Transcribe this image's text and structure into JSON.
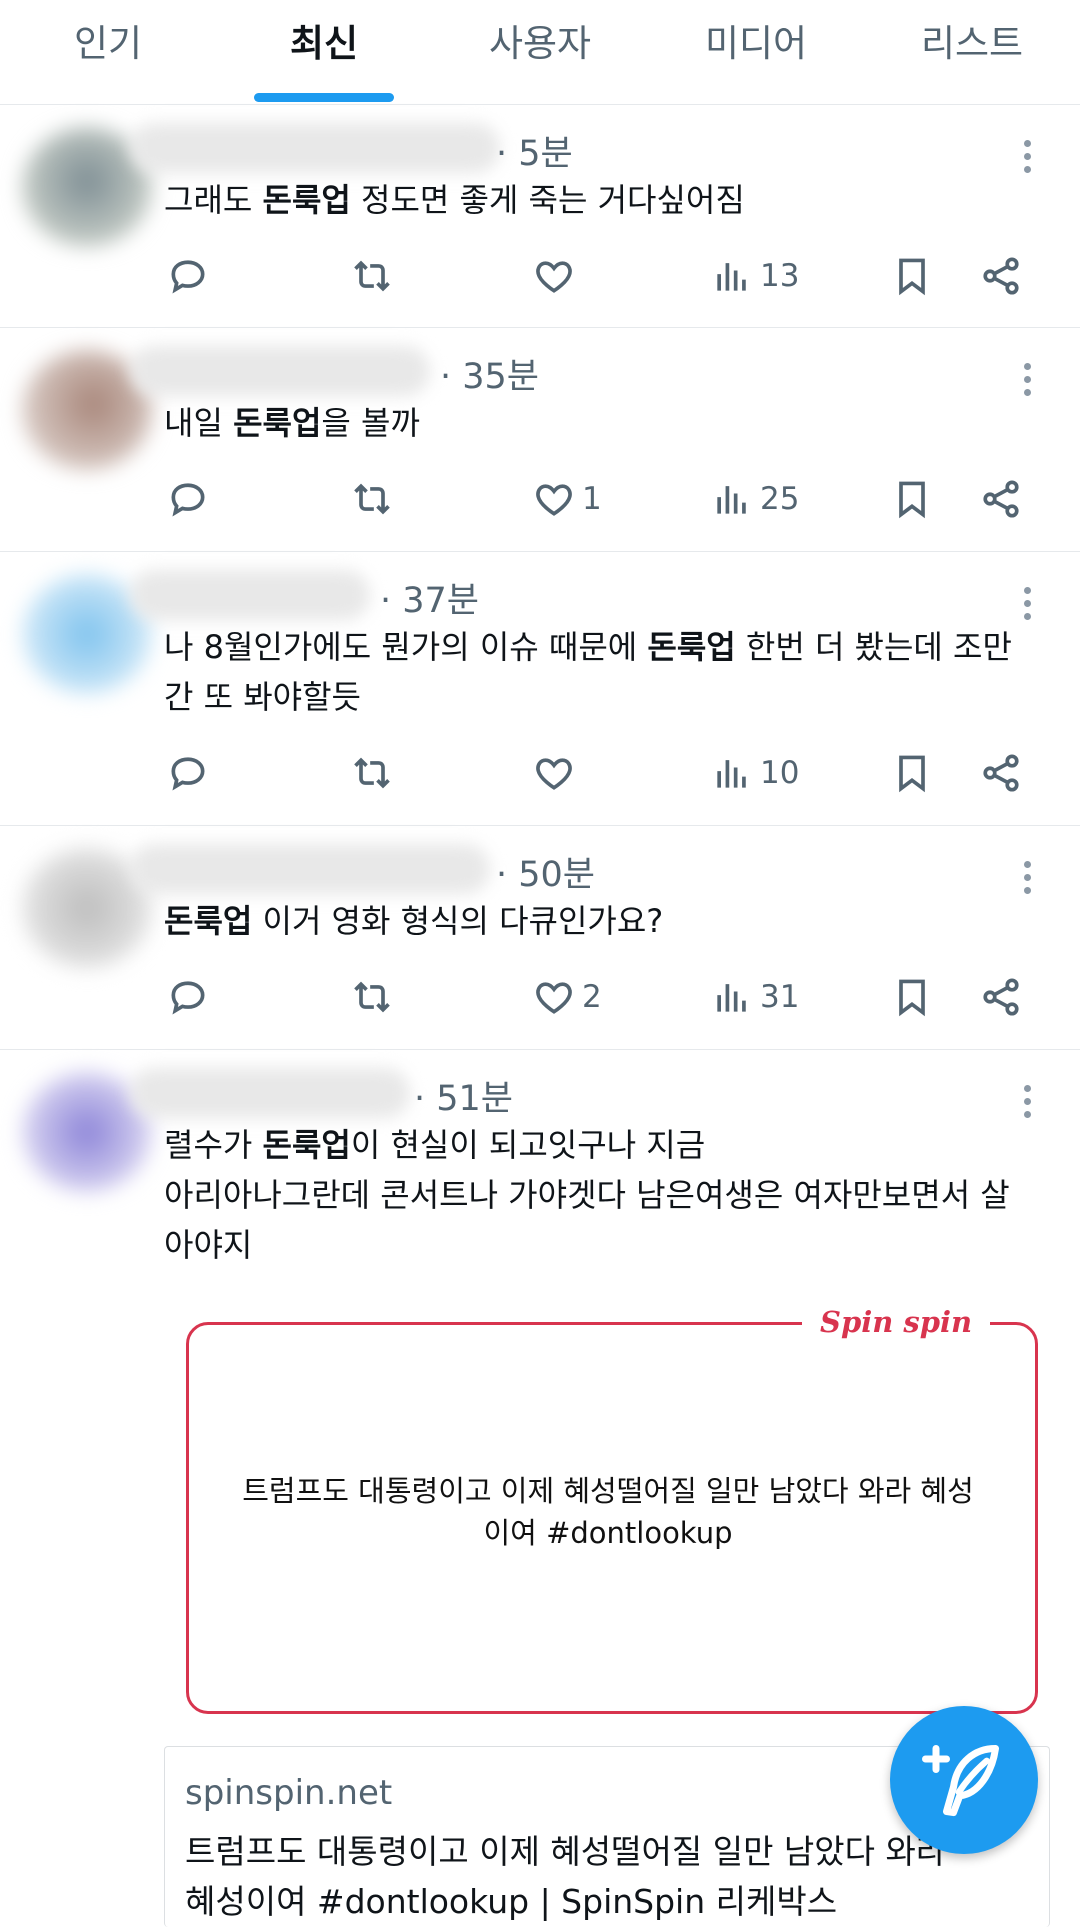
{
  "tabs": [
    {
      "label": "인기",
      "active": false
    },
    {
      "label": "최신",
      "active": true
    },
    {
      "label": "사용자",
      "active": false
    },
    {
      "label": "미디어",
      "active": false
    },
    {
      "label": "리스트",
      "active": false
    }
  ],
  "posts": [
    {
      "time": "· 5분",
      "text_parts": [
        "그래도 ",
        "돈룩업",
        " 정도면 좋게 죽는 거다싶어짐"
      ],
      "likes": "",
      "views": "13"
    },
    {
      "time": "· 35분",
      "text_parts": [
        "내일 ",
        "돈룩업",
        "을 볼까"
      ],
      "likes": "1",
      "views": "25"
    },
    {
      "time": "· 37분",
      "text_parts": [
        "나 8월인가에도 뭔가의 이슈 때문에 ",
        "돈룩업",
        " 한번 더 봤는데 조만간 또 봐야할듯"
      ],
      "likes": "",
      "views": "10"
    },
    {
      "time": "· 50분",
      "text_parts": [
        "",
        "돈룩업",
        " 이거 영화 형식의 다큐인가요?"
      ],
      "likes": "2",
      "views": "31"
    },
    {
      "time": "· 51분",
      "text_parts": [
        "렬수가 ",
        "돈룩업",
        "이 현실이 되고잇구나 지금"
      ],
      "text_line2": "아리아나그란데 콘서트나 가야겟다 남은여생은 여자만보면서 살아야지"
    }
  ],
  "card": {
    "brand": "Spin spin",
    "caption_line1": "트럼프도 대통령이고 이제 혜성떨어질 일만 남았다 와라 혜성",
    "caption_line2": "이여 #dontlookup",
    "domain": "spinspin.net",
    "title": "트럼프도 대통령이고 이제 혜성떨어질 일만 남았다 와라",
    "title_line2": "혜성이여 #dontlookup | SpinSpin 리케박스"
  },
  "colors": {
    "accent": "#1d9bf0",
    "brand_red": "#d8344e",
    "muted": "#536471"
  },
  "icons": [
    "reply-icon",
    "repost-icon",
    "like-icon",
    "views-icon",
    "bookmark-icon",
    "share-icon",
    "more-icon",
    "compose-icon"
  ]
}
